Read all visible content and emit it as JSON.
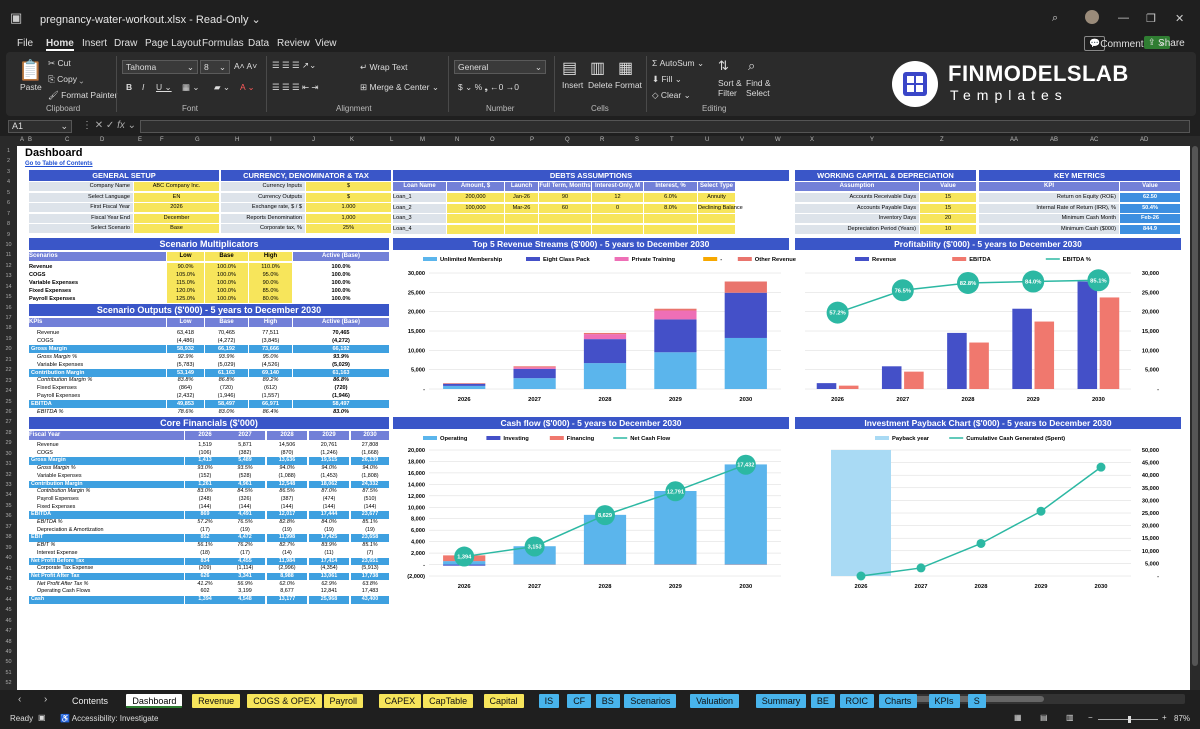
{
  "window": {
    "filename": "pregnancy-water-workout.xlsx",
    "mode": "Read-Only"
  },
  "menu": [
    "File",
    "Home",
    "Insert",
    "Draw",
    "Page Layout",
    "Formulas",
    "Data",
    "Review",
    "View"
  ],
  "menu_active": "Home",
  "comments_label": "Comments",
  "share_label": "Share",
  "ribbon": {
    "paste": "Paste",
    "cut": "Cut",
    "copy": "Copy",
    "format_painter": "Format Painter",
    "clipboard": "Clipboard",
    "font_name": "Tahoma",
    "font_size": "8",
    "font": "Font",
    "wrap_text": "Wrap Text",
    "merge_center": "Merge & Center",
    "alignment": "Alignment",
    "number_format": "General",
    "number": "Number",
    "insert": "Insert",
    "delete": "Delete",
    "format": "Format",
    "cells": "Cells",
    "autosum": "AutoSum",
    "fill": "Fill",
    "clear": "Clear",
    "sort_filter": "Sort & Filter",
    "find_select": "Find & Select",
    "editing": "Editing"
  },
  "brand": {
    "line1": "FINMODELSLAB",
    "line2": "Templates"
  },
  "formula_bar": {
    "name_box": "A1",
    "fx": "fx"
  },
  "columns": [
    "A",
    "B",
    "C",
    "D",
    "E",
    "F",
    "G",
    "H",
    "I",
    "J",
    "K",
    "L",
    "M",
    "N",
    "O",
    "P",
    "Q",
    "R",
    "S",
    "T",
    "U",
    "V",
    "W",
    "X",
    "Y",
    "Z",
    "AA",
    "AB",
    "AC",
    "AD"
  ],
  "sheet": {
    "title": "Dashboard",
    "toc_link": "Go to Table of Contents",
    "general": {
      "header": "GENERAL SETUP",
      "rows": [
        [
          "Company Name",
          "ABC Company Inc."
        ],
        [
          "Select Language",
          "EN"
        ],
        [
          "First Fiscal Year",
          "2026"
        ],
        [
          "Fiscal Year End",
          "December"
        ],
        [
          "Select Scenario",
          "Base"
        ]
      ]
    },
    "currency": {
      "header": "CURRENCY, DENOMINATOR & TAX",
      "rows": [
        [
          "Currency Inputs",
          "$"
        ],
        [
          "Currency Outputs",
          "$"
        ],
        [
          "Exchange rate, $ / $",
          "1.000"
        ],
        [
          "Reports Denomination",
          "1,000"
        ],
        [
          "Corporate tax, %",
          "25%"
        ]
      ]
    },
    "debts": {
      "header": "DEBTS ASSUMPTIONS",
      "cols": [
        "Loan Name",
        "Amount, $",
        "Launch",
        "Full Term, Months",
        "Interest-Only, M",
        "Interest, %",
        "Select Type"
      ],
      "rows": [
        [
          "Loan_1",
          "200,000",
          "Jan-26",
          "90",
          "12",
          "6.0%",
          "Annuity"
        ],
        [
          "Loan_2",
          "100,000",
          "Mar-26",
          "60",
          "0",
          "8.0%",
          "Declining Balance"
        ],
        [
          "Loan_3",
          "",
          "",
          "",
          "",
          "",
          ""
        ],
        [
          "Loan_4",
          "",
          "",
          "",
          "",
          "",
          ""
        ]
      ]
    },
    "wc": {
      "header": "WORKING CAPITAL & DEPRECIATION",
      "cols": [
        "Assumption",
        "Value"
      ],
      "rows": [
        [
          "Accounts Receivable Days",
          "15"
        ],
        [
          "Accounts Payable Days",
          "15"
        ],
        [
          "Inventory Days",
          "20"
        ],
        [
          "Depreciation Period (Years)",
          "10"
        ]
      ]
    },
    "kpi": {
      "header": "KEY METRICS",
      "cols": [
        "KPI",
        "Value"
      ],
      "rows": [
        [
          "Return on Equity (ROE)",
          "62.50"
        ],
        [
          "Internal Rate of Return (IRR), %",
          "50.4%"
        ],
        [
          "Minimum Cash Month",
          "Feb-26"
        ],
        [
          "Minimum Cash ($000)",
          "844.9"
        ]
      ]
    },
    "scenario_mult": {
      "header": "Scenario Multiplicators",
      "cols": [
        "Scenarios",
        "Low",
        "Base",
        "High",
        "Active (Base)"
      ],
      "rows": [
        [
          "Revenue",
          "90.0%",
          "100.0%",
          "110.0%",
          "100.0%"
        ],
        [
          "COGS",
          "105.0%",
          "100.0%",
          "95.0%",
          "100.0%"
        ],
        [
          "Variable Expenses",
          "115.0%",
          "100.0%",
          "90.0%",
          "100.0%"
        ],
        [
          "Fixed Expenses",
          "120.0%",
          "100.0%",
          "85.0%",
          "100.0%"
        ],
        [
          "Payroll Expenses",
          "125.0%",
          "100.0%",
          "80.0%",
          "100.0%"
        ]
      ]
    },
    "scenario_out": {
      "header": "Scenario Outputs ($'000) - 5 years to December 2030",
      "cols": [
        "KPIs",
        "Low",
        "Base",
        "High",
        "Active (Base)"
      ],
      "rows": [
        [
          "Revenue",
          "63,418",
          "70,465",
          "77,511",
          "70,465",
          "n"
        ],
        [
          "COGS",
          "(4,486)",
          "(4,272)",
          "(3,845)",
          "(4,272)",
          "n"
        ],
        [
          "Gross Margin",
          "58,932",
          "66,192",
          "73,666",
          "66,192",
          "h"
        ],
        [
          "Gross Margin %",
          "92.9%",
          "93.9%",
          "95.0%",
          "93.9%",
          "i"
        ],
        [
          "Variable Expenses",
          "(5,783)",
          "(5,029)",
          "(4,526)",
          "(5,029)",
          "n"
        ],
        [
          "Contribution Margin",
          "53,149",
          "61,163",
          "69,140",
          "61,163",
          "h"
        ],
        [
          "Contribution Margin %",
          "83.8%",
          "86.8%",
          "89.2%",
          "86.8%",
          "i"
        ],
        [
          "Fixed Expenses",
          "(864)",
          "(720)",
          "(612)",
          "(720)",
          "n"
        ],
        [
          "Payroll Expenses",
          "(2,432)",
          "(1,946)",
          "(1,557)",
          "(1,946)",
          "n"
        ],
        [
          "EBITDA",
          "49,853",
          "58,497",
          "66,971",
          "58,497",
          "h"
        ],
        [
          "EBITDA %",
          "78.6%",
          "83.0%",
          "86.4%",
          "83.0%",
          "i"
        ]
      ]
    },
    "core": {
      "header": "Core Financials ($'000)",
      "cols": [
        "Fiscal Year",
        "2026",
        "2027",
        "2028",
        "2029",
        "2030"
      ],
      "rows": [
        [
          "Revenue",
          "1,519",
          "5,871",
          "14,506",
          "20,761",
          "27,808",
          "n"
        ],
        [
          "COGS",
          "(106)",
          "(382)",
          "(870)",
          "(1,246)",
          "(1,668)",
          "n"
        ],
        [
          "Gross Margin",
          "1,413",
          "5,489",
          "13,636",
          "19,515",
          "26,139",
          "h"
        ],
        [
          "Gross Margin %",
          "93.0%",
          "93.5%",
          "94.0%",
          "94.0%",
          "94.0%",
          "i"
        ],
        [
          "Variable Expenses",
          "(152)",
          "(528)",
          "(1,088)",
          "(1,453)",
          "(1,808)",
          "n"
        ],
        [
          "Contribution Margin",
          "1,261",
          "4,961",
          "12,548",
          "18,062",
          "24,332",
          "h"
        ],
        [
          "Contribution Margin %",
          "83.0%",
          "84.5%",
          "86.5%",
          "87.0%",
          "87.5%",
          "i"
        ],
        [
          "Payroll Expenses",
          "(248)",
          "(326)",
          "(387)",
          "(474)",
          "(510)",
          "n"
        ],
        [
          "Fixed Expenses",
          "(144)",
          "(144)",
          "(144)",
          "(144)",
          "(144)",
          "n"
        ],
        [
          "EBITDA",
          "869",
          "4,491",
          "12,017",
          "17,444",
          "23,677",
          "h"
        ],
        [
          "EBITDA %",
          "57.2%",
          "76.5%",
          "82.8%",
          "84.0%",
          "85.1%",
          "i"
        ],
        [
          "Depreciation & Amortization",
          "(17)",
          "(19)",
          "(19)",
          "(19)",
          "(19)",
          "n"
        ],
        [
          "EBIT",
          "852",
          "4,472",
          "11,998",
          "17,425",
          "23,658",
          "h"
        ],
        [
          "EBIT %",
          "56.1%",
          "76.2%",
          "82.7%",
          "83.9%",
          "85.1%",
          "i"
        ],
        [
          "Interest Expense",
          "(18)",
          "(17)",
          "(14)",
          "(11)",
          "(7)",
          "n"
        ],
        [
          "Net Profit Before Tax",
          "834",
          "4,455",
          "11,984",
          "17,414",
          "23,651",
          "h"
        ],
        [
          "Corporate Tax Expense",
          "(209)",
          "(1,114)",
          "(2,996)",
          "(4,354)",
          "(5,913)",
          "n"
        ],
        [
          "Net Profit After Tax",
          "626",
          "3,341",
          "8,988",
          "13,061",
          "17,738",
          "h"
        ],
        [
          "Net Profit After Tax %",
          "41.2%",
          "56.9%",
          "62.0%",
          "62.9%",
          "63.8%",
          "i"
        ],
        [
          "Operating Cash Flows",
          "602",
          "3,199",
          "8,677",
          "12,841",
          "17,483",
          "n"
        ],
        [
          "Cash",
          "1,394",
          "4,548",
          "13,177",
          "25,968",
          "43,400",
          "h"
        ]
      ]
    }
  },
  "chart_data": [
    {
      "type": "bar",
      "title": "Top 5 Revenue Streams ($'000) - 5 years to December 2030",
      "categories": [
        "2026",
        "2027",
        "2028",
        "2029",
        "2030"
      ],
      "ylim": [
        0,
        30000
      ],
      "yticks": [
        "-",
        "5,000",
        "10,000",
        "15,000",
        "20,000",
        "25,000",
        "30,000"
      ],
      "series": [
        {
          "name": "Unlimited Membership",
          "color": "#5bb5ec",
          "values": [
            800,
            2800,
            6700,
            9500,
            13200
          ]
        },
        {
          "name": "Eight Class Pack",
          "color": "#4450c8",
          "values": [
            550,
            2400,
            6200,
            8500,
            11700
          ]
        },
        {
          "name": "Private Training",
          "color": "#ee6fb6",
          "values": [
            0,
            400,
            1300,
            2300,
            0
          ]
        },
        {
          "name": "-",
          "color": "#f7a800",
          "values": [
            0,
            0,
            0,
            0,
            0
          ]
        },
        {
          "name": "Other Revenue",
          "color": "#e9746d",
          "values": [
            170,
            270,
            300,
            460,
            2900
          ]
        }
      ]
    },
    {
      "type": "bar+line",
      "title": "Profitability ($'000) - 5 years to December 2030",
      "categories": [
        "2026",
        "2027",
        "2028",
        "2029",
        "2030"
      ],
      "ylim": [
        0,
        30000
      ],
      "yticks": [
        "-",
        "5,000",
        "10,000",
        "15,000",
        "20,000",
        "25,000",
        "30,000"
      ],
      "series": [
        {
          "name": "Revenue",
          "color": "#4450c8",
          "values": [
            1519,
            5871,
            14506,
            20761,
            27808
          ]
        },
        {
          "name": "EBITDA",
          "color": "#f0786e",
          "values": [
            869,
            4491,
            12017,
            17444,
            23677
          ]
        },
        {
          "name": "EBITDA %",
          "color": "#2cb8a3",
          "values": [
            57.2,
            76.5,
            82.8,
            84.0,
            85.1
          ],
          "labels": [
            "57.2%",
            "76.5%",
            "82.8%",
            "84.0%",
            "85.1%"
          ]
        }
      ]
    },
    {
      "type": "bar+line",
      "title": "Cash flow ($'000) - 5 years to December 2030",
      "categories": [
        "2026",
        "2027",
        "2028",
        "2029",
        "2030"
      ],
      "ylim": [
        -2000,
        20000
      ],
      "yticks": [
        "(2,000)",
        "-",
        "2,000",
        "4,000",
        "6,000",
        "8,000",
        "10,000",
        "12,000",
        "14,000",
        "16,000",
        "18,000",
        "20,000"
      ],
      "series": [
        {
          "name": "Operating",
          "color": "#5bb5ec",
          "values": [
            602,
            3199,
            8677,
            12841,
            17483
          ]
        },
        {
          "name": "Investing",
          "color": "#4450c8",
          "values": [
            -200,
            0,
            0,
            0,
            0
          ]
        },
        {
          "name": "Financing",
          "color": "#f0786e",
          "values": [
            1000,
            -40,
            -50,
            -50,
            -50
          ]
        },
        {
          "name": "Net Cash Flow",
          "color": "#2cb8a3",
          "values": [
            1394,
            3153,
            8629,
            12791,
            17432
          ],
          "labels": [
            "1,394",
            "3,153",
            "8,629",
            "12,791",
            "17,432"
          ]
        }
      ]
    },
    {
      "type": "area+line",
      "title": "Investment Payback Chart ($'000) - 5 years to December 2030",
      "categories": [
        "2026",
        "2027",
        "2028",
        "2029",
        "2030"
      ],
      "ylim": [
        0,
        50000
      ],
      "yticks": [
        "-",
        "5,000",
        "10,000",
        "15,000",
        "20,000",
        "25,000",
        "30,000",
        "35,000",
        "40,000",
        "45,000",
        "50,000"
      ],
      "series": [
        {
          "name": "Payback year",
          "color": "#a9daf4",
          "values": [
            50000,
            0,
            0,
            0,
            0
          ]
        },
        {
          "name": "Cumulative Cash Generated (Spent)",
          "color": "#2cb8a3",
          "values": [
            0,
            3200,
            12900,
            25700,
            43200
          ]
        }
      ]
    }
  ],
  "tabs": [
    {
      "label": "Contents",
      "c": "none"
    },
    {
      "label": "Dashboard",
      "c": "active"
    },
    {
      "label": "Revenue",
      "c": "#f7e55b"
    },
    {
      "label": "COGS & OPEX",
      "c": "#f7e55b"
    },
    {
      "label": "Payroll",
      "c": "#f7e55b"
    },
    {
      "label": "CAPEX",
      "c": "#f7e55b"
    },
    {
      "label": "CapTable",
      "c": "#f7e55b"
    },
    {
      "label": "Capital",
      "c": "#f7e55b"
    },
    {
      "label": "IS",
      "c": "#48b4ec"
    },
    {
      "label": "CF",
      "c": "#48b4ec"
    },
    {
      "label": "BS",
      "c": "#48b4ec"
    },
    {
      "label": "Scenarios",
      "c": "#48b4ec"
    },
    {
      "label": "Valuation",
      "c": "#48b4ec"
    },
    {
      "label": "Summary",
      "c": "#48b4ec"
    },
    {
      "label": "BE",
      "c": "#48b4ec"
    },
    {
      "label": "ROIC",
      "c": "#48b4ec"
    },
    {
      "label": "Charts",
      "c": "#48b4ec"
    },
    {
      "label": "KPIs",
      "c": "#48b4ec"
    },
    {
      "label": "S",
      "c": "#48b4ec"
    }
  ],
  "status": {
    "ready": "Ready",
    "accessibility": "Accessibility: Investigate",
    "zoom": "87%"
  }
}
